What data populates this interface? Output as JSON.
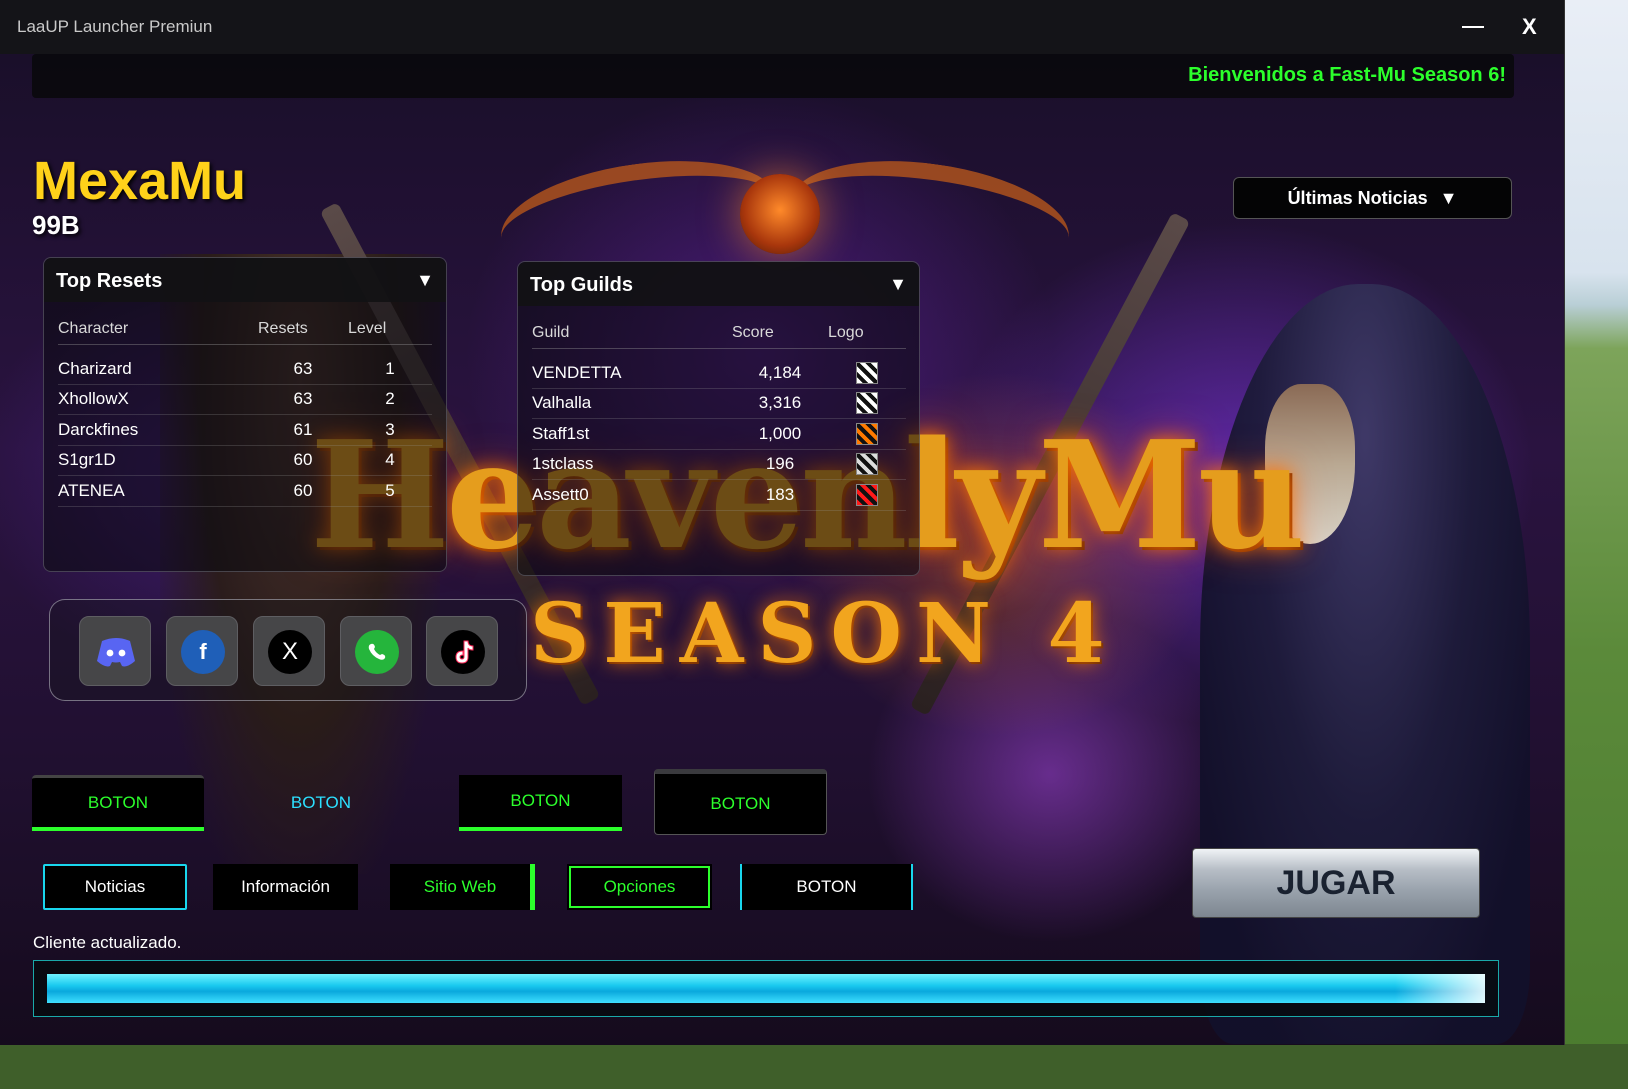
{
  "window": {
    "title": "LaaUP Launcher Premiun",
    "close_label": "X"
  },
  "marquee": {
    "text": "Bienvenidos a Fast-Mu Season 6!"
  },
  "server": {
    "name": "MexaMu",
    "subtitle": "99B"
  },
  "banner": {
    "title": "HeavenlyMu",
    "subtitle": "SEASON 4"
  },
  "news_dropdown": {
    "label": "Últimas Noticias",
    "arrow": "▼"
  },
  "top_resets": {
    "title": "Top Resets",
    "arrow": "▼",
    "columns": [
      "Character",
      "Resets",
      "Level"
    ],
    "rows": [
      [
        "Charizard",
        "63",
        "1"
      ],
      [
        "XhollowX",
        "63",
        "2"
      ],
      [
        "Darckfines",
        "61",
        "3"
      ],
      [
        "S1gr1D",
        "60",
        "4"
      ],
      [
        "ATENEA",
        "60",
        "5"
      ]
    ]
  },
  "top_guilds": {
    "title": "Top Guilds",
    "arrow": "▼",
    "columns": [
      "Guild",
      "Score",
      "Logo"
    ],
    "rows": [
      [
        "VENDETTA",
        "4,184"
      ],
      [
        "Valhalla",
        "3,316"
      ],
      [
        "Staff1st",
        "1,000"
      ],
      [
        "1stclass",
        "196"
      ],
      [
        "Assett0",
        "183"
      ]
    ],
    "logo_colors": [
      "#ffffff",
      "#ffffff",
      "#ff7a00",
      "#dddddd",
      "#ff1a1a"
    ]
  },
  "social": {
    "discord": "discord-icon",
    "facebook": "f",
    "x": "X",
    "whatsapp": "whatsapp-icon",
    "tiktok": "tiktok-icon"
  },
  "buttons_row1": [
    "BOTON",
    "BOTON",
    "BOTON",
    "BOTON"
  ],
  "buttons_row2": [
    "Noticias",
    "Información",
    "Sitio Web",
    "Opciones",
    "BOTON"
  ],
  "play_button": "JUGAR",
  "status": {
    "text": "Cliente actualizado.",
    "progress": 1.0
  },
  "colors": {
    "accent_green": "#2cff2c",
    "accent_cyan": "#19d6ee",
    "server_yellow": "#ffd21a"
  }
}
